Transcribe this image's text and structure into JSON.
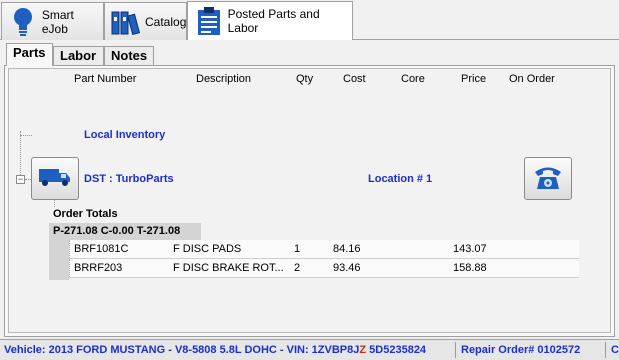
{
  "top_tabs": [
    {
      "label": "Smart eJob",
      "icon": "lightbulb-icon"
    },
    {
      "label": "Catalog",
      "icon": "binders-icon"
    },
    {
      "label": "Posted Parts and Labor",
      "icon": "clipboard-icon",
      "active": true
    }
  ],
  "sub_tabs": [
    {
      "label": "Parts",
      "active": true
    },
    {
      "label": "Labor"
    },
    {
      "label": "Notes"
    }
  ],
  "columns": [
    "Part Number",
    "Description",
    "Qty",
    "Cost",
    "Core",
    "Price",
    "On Order"
  ],
  "tree": {
    "local_inventory": "Local Inventory",
    "vendor": "DST : TurboParts",
    "location": "Location # 1",
    "expander": "−"
  },
  "order_totals": {
    "label": "Order Totals",
    "summary": "P-271.08 C-0.00 T-271.08"
  },
  "rows": [
    {
      "part_number": "BRF1081C",
      "description": "F DISC PADS",
      "qty": "1",
      "cost": "84.16",
      "core": "",
      "price": "143.07",
      "on_order": ""
    },
    {
      "part_number": "BRRF203",
      "description": "F DISC BRAKE ROT...",
      "qty": "2",
      "cost": "93.46",
      "core": "",
      "price": "158.88",
      "on_order": ""
    }
  ],
  "status": {
    "vehicle_prefix": "Vehicle: 2013 FORD MUSTANG  -  V8-5808 5.8L DOHC  -  VIN: 1ZVBP8J",
    "vin_highlight": "Z",
    "vin_suffix": " 5D5235824",
    "repair_order": "Repair Order# 0102572",
    "trailing": "C"
  },
  "colors": {
    "link_blue": "#1a2fd0",
    "vin_warning": "#d03000"
  }
}
